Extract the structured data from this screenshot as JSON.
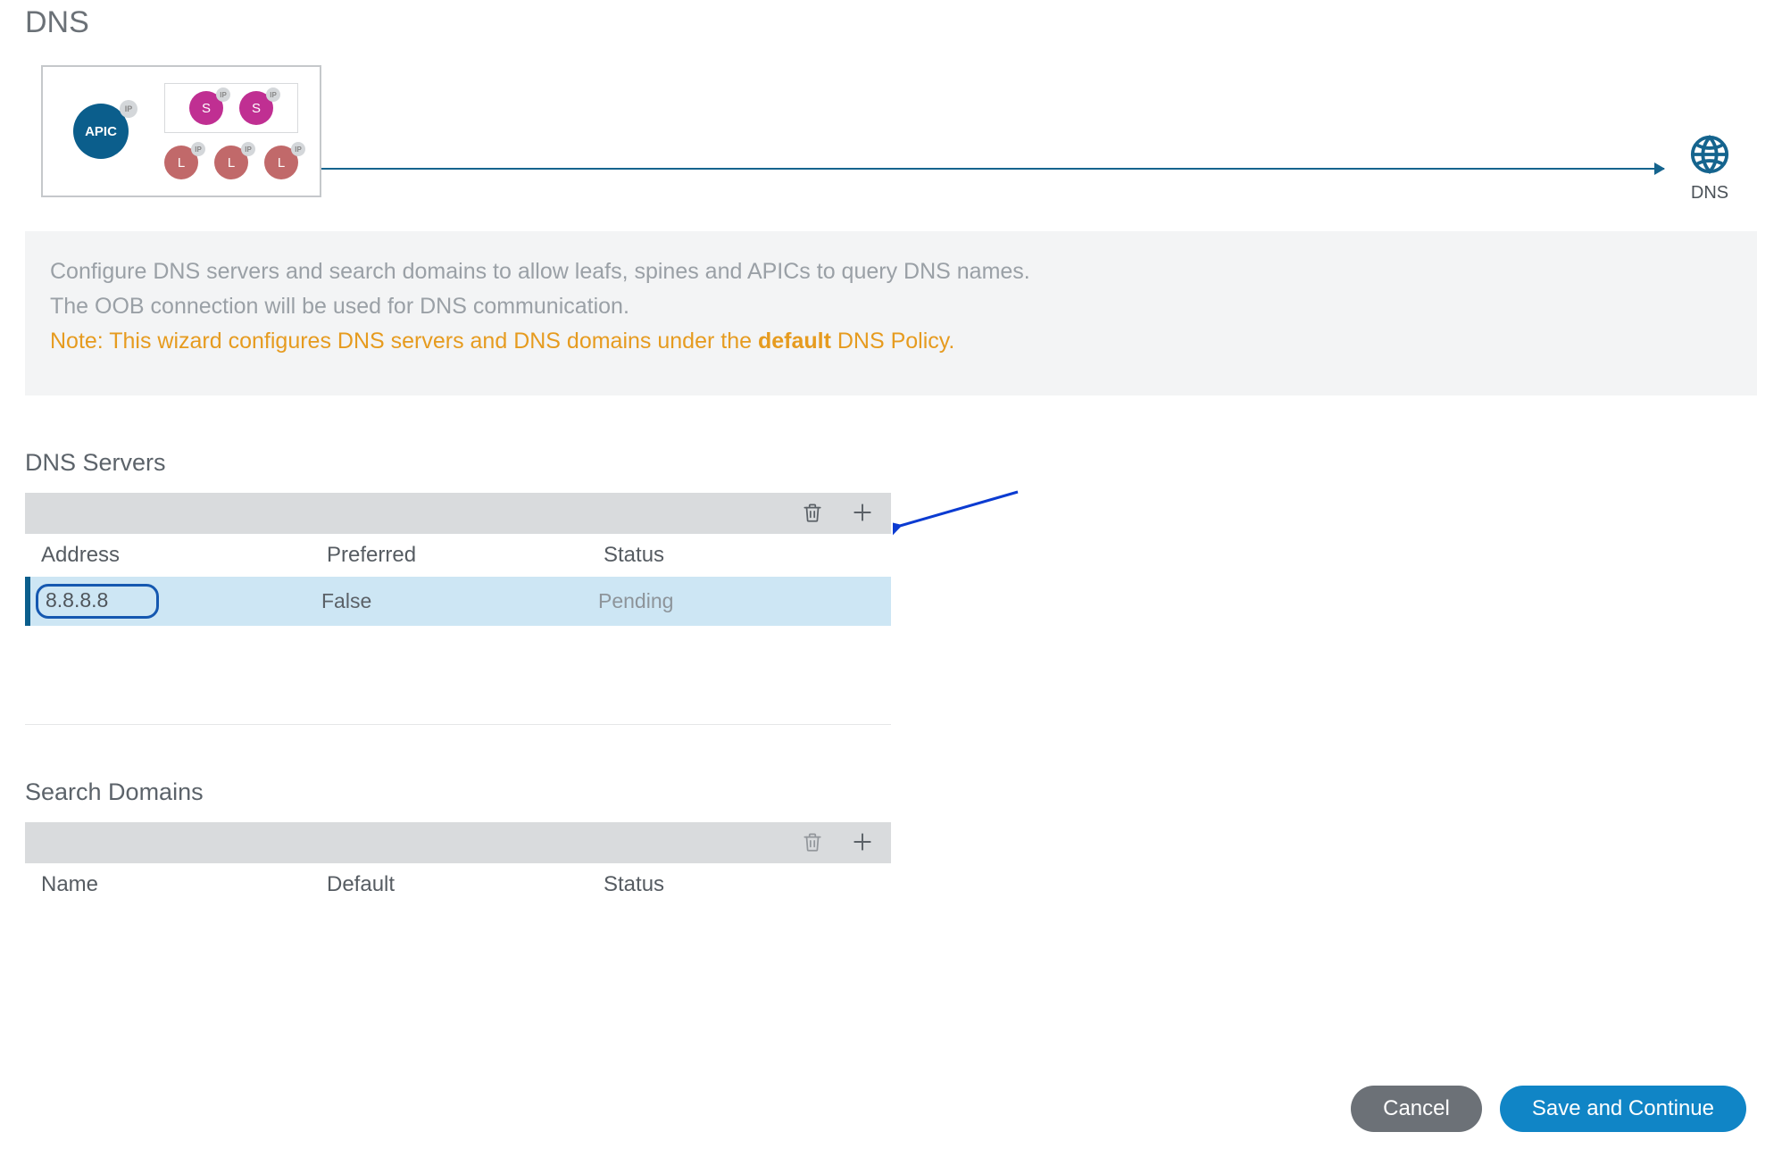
{
  "page_title": "DNS",
  "topology": {
    "apic_label": "APIC",
    "spine_label": "S",
    "leaf_label": "L",
    "target_label": "DNS"
  },
  "info": {
    "line1": "Configure DNS servers and search domains to allow leafs, spines and APICs to query DNS names.",
    "line2": "The OOB connection will be used for DNS communication.",
    "note_pre": "Note: This wizard configures DNS servers and DNS domains under the ",
    "note_bold": "default",
    "note_post": " DNS Policy."
  },
  "dns_servers": {
    "title": "DNS Servers",
    "headers": {
      "address": "Address",
      "preferred": "Preferred",
      "status": "Status"
    },
    "rows": [
      {
        "address": "8.8.8.8",
        "preferred": "False",
        "status": "Pending"
      }
    ]
  },
  "search_domains": {
    "title": "Search Domains",
    "headers": {
      "name": "Name",
      "default_": "Default",
      "status": "Status"
    },
    "rows": []
  },
  "buttons": {
    "cancel": "Cancel",
    "save": "Save and Continue"
  }
}
